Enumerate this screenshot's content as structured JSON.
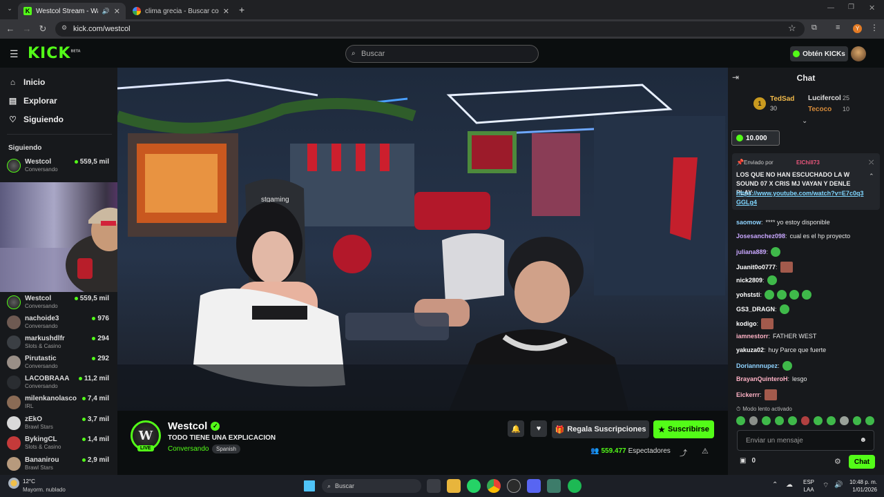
{
  "browser": {
    "tabs": [
      {
        "label": "Westcol Stream - Watch Li",
        "active": true
      },
      {
        "label": "clima grecia - Buscar con Goog",
        "active": false
      }
    ],
    "address": "kick.com/westcol"
  },
  "header": {
    "logo": "KICK",
    "logo_sup": "BETA",
    "search_placeholder": "Buscar",
    "get_kicks_label": "Obtén KICKs"
  },
  "sidebar": {
    "nav": [
      {
        "label": "Inicio",
        "icon": "home-icon"
      },
      {
        "label": "Explorar",
        "icon": "explore-icon"
      },
      {
        "label": "Siguiendo",
        "icon": "heart-icon"
      }
    ],
    "following_title": "Siguiendo",
    "following": [
      {
        "name": "Westcol",
        "category": "Conversando",
        "viewers": "559,5 mil"
      }
    ],
    "recommended": [
      {
        "name": "Westcol",
        "category": "Conversando",
        "viewers": "559,5 mil"
      },
      {
        "name": "nachoide3",
        "category": "Conversando",
        "viewers": "976"
      },
      {
        "name": "markushdlfr",
        "category": "Slots & Casino",
        "viewers": "294"
      },
      {
        "name": "Pirutastic",
        "category": "Conversando",
        "viewers": "292"
      },
      {
        "name": "LACOBRAAA",
        "category": "Conversando",
        "viewers": "11,2 mil"
      },
      {
        "name": "milenkanolasco",
        "category": "IRL",
        "viewers": "7,4 mil"
      },
      {
        "name": "zEkO",
        "category": "Brawl Stars",
        "viewers": "3,7 mil"
      },
      {
        "name": "BykingCL",
        "category": "Slots & Casino",
        "viewers": "1,4 mil"
      },
      {
        "name": "Bananirou",
        "category": "Brawl Stars",
        "viewers": "2,9 mil"
      }
    ]
  },
  "stream": {
    "streamer": "Westcol",
    "title": "TODO TIENE UNA EXPLICACION",
    "category": "Conversando",
    "language": "Spanish",
    "live_label": "LIVE",
    "gift_label": "Regala Suscripciones",
    "subscribe_label": "Suscribirse",
    "viewers": "559.477",
    "viewers_label": "Espectadores",
    "chair_brand": "stgaming"
  },
  "chat": {
    "title": "Chat",
    "leaderboard": [
      {
        "rank": "1",
        "name": "TedSad",
        "value": "30"
      },
      {
        "name": "Lucifercol",
        "value": "25"
      },
      {
        "name": "Tecoco",
        "value": "10"
      }
    ],
    "kicks_amount": "10.000",
    "pinned": {
      "sent_by_label": "Enviado por",
      "sent_by_user": "ElChill73",
      "text": "LOS QUE NO HAN ESCUCHADO LA W SOUND 07 X CRIS MJ VAYAN Y DENLE PLAY",
      "link": "https://www.youtube.com/watch?v=E7c0q3GGLg4"
    },
    "messages": [
      {
        "user": "saomow",
        "text": "**** yo estoy disponible",
        "color": "#8fd3ff",
        "emotes": 0
      },
      {
        "user": "Josesanchez098",
        "text": "cual es el hp proyecto",
        "color": "#c9a7ff",
        "emotes": 0
      },
      {
        "user": "juliana889",
        "text": "",
        "color": "#c9a7ff",
        "emotes": 1
      },
      {
        "user": "Juanit0o0777",
        "text": "",
        "color": "#ffffff",
        "emotes": 1
      },
      {
        "user": "nick2809",
        "text": "",
        "color": "#ffffff",
        "emotes": 1
      },
      {
        "user": "yohststi",
        "text": "",
        "color": "#ffffff",
        "emotes": 4
      },
      {
        "user": "GS3_DRAGN",
        "text": "",
        "color": "#ffffff",
        "emotes": 1
      },
      {
        "user": "kodigo",
        "text": "",
        "color": "#ffffff",
        "emotes": 1
      },
      {
        "user": "iamnestorr",
        "text": "FATHER WEST",
        "color": "#ffb3c6",
        "emotes": 0
      },
      {
        "user": "yakuza02",
        "text": "huy Parce que fuerte",
        "color": "#ffffff",
        "emotes": 0
      },
      {
        "user": "Doriannnupez",
        "text": "",
        "color": "#8fd3ff",
        "emotes": 1
      },
      {
        "user": "BrayanQuinteroH",
        "text": "lesgo",
        "color": "#ffb3c6",
        "emotes": 0
      },
      {
        "user": "Eickerrr",
        "text": "",
        "color": "#ffb3c6",
        "emotes": 1
      }
    ],
    "slow_mode": "Modo lento activado",
    "input_placeholder": "Enviar un mensaje",
    "points": "0",
    "send_label": "Chat"
  },
  "taskbar": {
    "weather_temp": "12°C",
    "weather_desc": "Mayorm. nublado",
    "search_label": "Buscar",
    "lang1": "ESP",
    "lang2": "LAA",
    "time": "10:48 p. m.",
    "date": "1/01/2026"
  },
  "colors": {
    "accent": "#53fc18",
    "bg": "#0b0e0f",
    "panel": "#17191c"
  }
}
